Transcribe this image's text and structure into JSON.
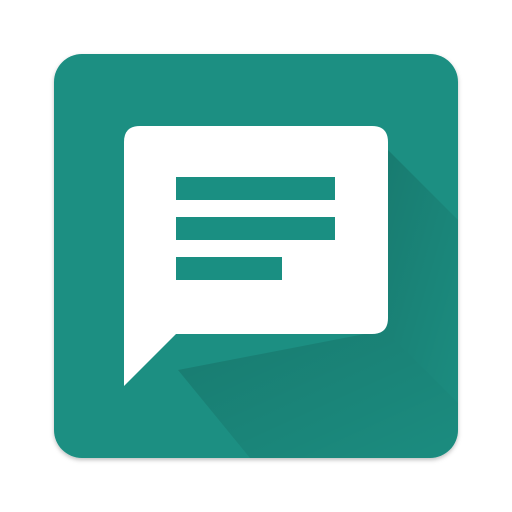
{
  "icon": {
    "name": "chat-message-app-icon",
    "glyph": "message-text-icon",
    "tile_color": "#1a8f82",
    "tile_shadow_color": "#0f6f64",
    "bubble_color": "#ffffff",
    "line_color": "#1a8f82"
  }
}
